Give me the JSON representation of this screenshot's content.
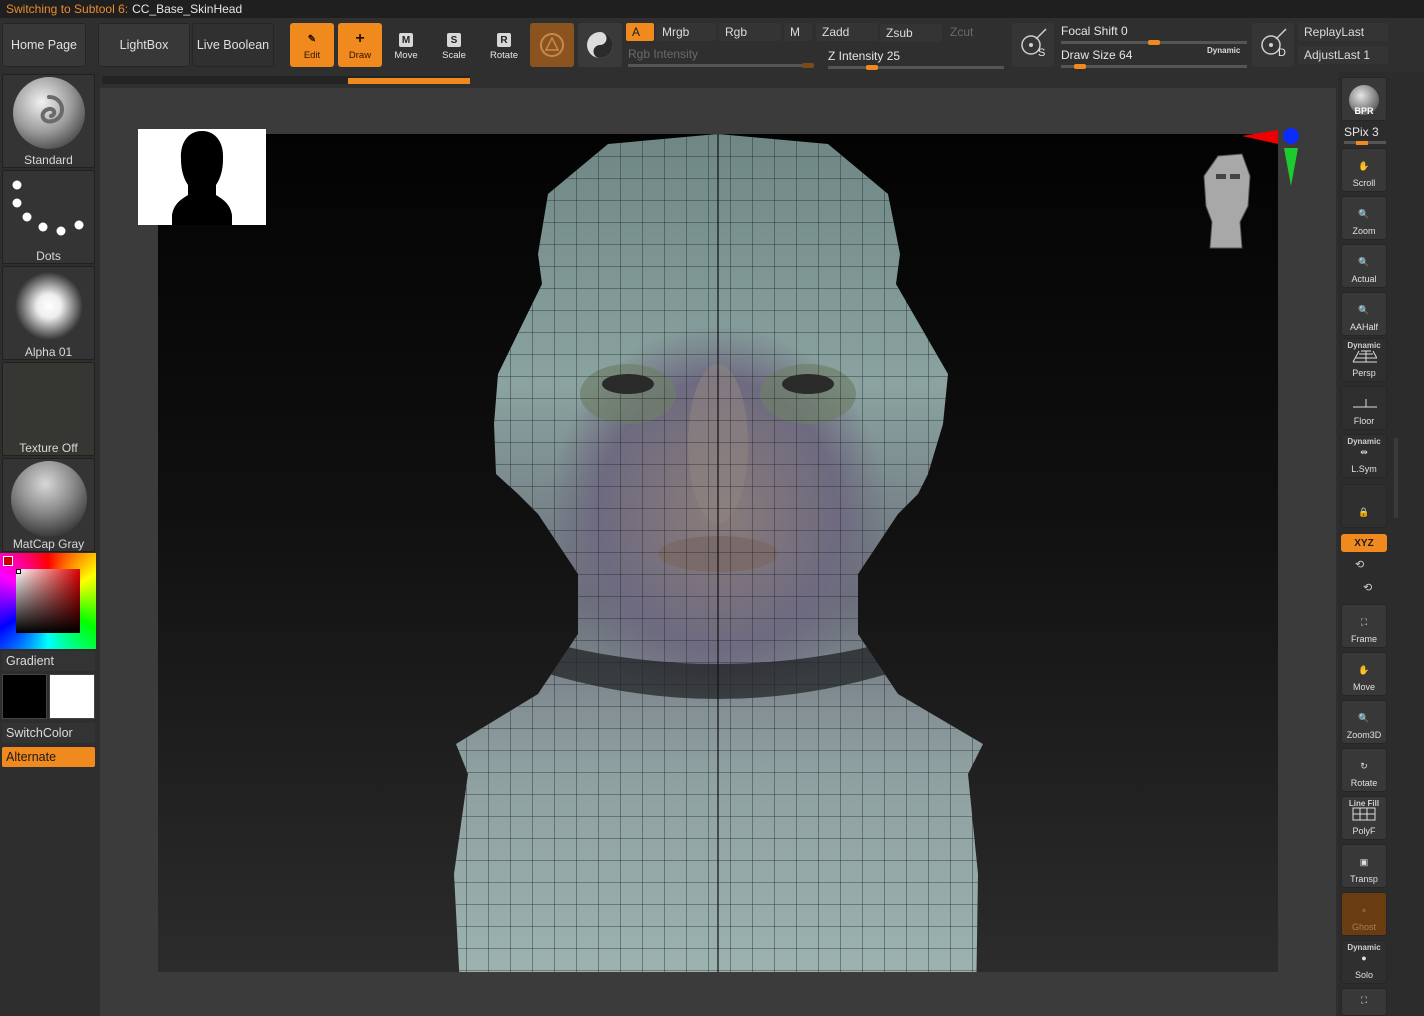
{
  "titlebar": {
    "status": "Switching to Subtool 6:",
    "subtool": "CC_Base_SkinHead"
  },
  "nav": {
    "home": "Home Page",
    "lightbox": "LightBox",
    "live_boolean": "Live Boolean"
  },
  "tools": {
    "edit": {
      "label": "Edit",
      "glyph": "✎"
    },
    "draw": {
      "label": "Draw",
      "glyph": "+"
    },
    "move": {
      "label": "Move",
      "glyph": "M"
    },
    "scale": {
      "label": "Scale",
      "glyph": "S"
    },
    "rotate": {
      "label": "Rotate",
      "glyph": "R"
    }
  },
  "color_modes": {
    "a": "A",
    "mrgb": "Mrgb",
    "rgb": "Rgb",
    "m": "M",
    "zadd": "Zadd",
    "zsub": "Zsub",
    "zcut": "Zcut"
  },
  "sliders": {
    "rgb_intensity": {
      "label": "Rgb Intensity",
      "value": "",
      "fraction": 0.98
    },
    "z_intensity": {
      "label": "Z Intensity",
      "value": "25",
      "fraction": 0.25
    },
    "focal_shift": {
      "label": "Focal Shift",
      "value": "0",
      "fraction": 0.5
    },
    "draw_size": {
      "label": "Draw Size",
      "value": "64",
      "fraction": 0.1
    }
  },
  "dynamic_label": "Dynamic",
  "lazy": {
    "s": "S",
    "d": "D"
  },
  "replay": {
    "replay_last": "ReplayLast",
    "adjust_last": "AdjustLast",
    "adjust_value": "1"
  },
  "left": {
    "brush": "Standard",
    "stroke": "Dots",
    "alpha": "Alpha 01",
    "texture": "Texture Off",
    "material": "MatCap Gray",
    "gradient": "Gradient",
    "switch_color": "SwitchColor",
    "alternate": "Alternate"
  },
  "right": {
    "bpr": "BPR",
    "spix_label": "SPix",
    "spix_value": "3",
    "scroll": "Scroll",
    "zoom": "Zoom",
    "actual": "Actual",
    "aahalf": "AAHalf",
    "dynamic": "Dynamic",
    "persp": "Persp",
    "floor": "Floor",
    "lsym": "L.Sym",
    "xyz": "XYZ",
    "frame": "Frame",
    "move": "Move",
    "zoom3d": "Zoom3D",
    "rotate": "Rotate",
    "linefill": "Line Fill",
    "polyf": "PolyF",
    "transp": "Transp",
    "ghost": "Ghost",
    "solo": "Solo"
  },
  "colors": {
    "accent": "#f08a1e",
    "primary": "#000000",
    "secondary": "#ffffff"
  }
}
